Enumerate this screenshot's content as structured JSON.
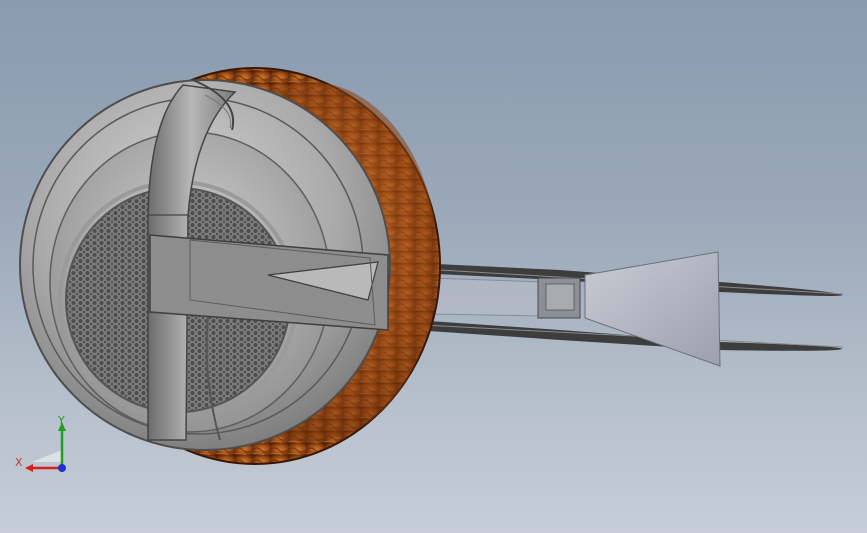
{
  "viewport": {
    "background_top": "#8a9bb0",
    "background_bottom": "#c6cdd6"
  },
  "model": {
    "wood_color": "#9a4a12",
    "metal_color": "#8f8f8f",
    "mesh_color": "#6e6e6e",
    "rod_color": "#3a3a3a"
  },
  "triad": {
    "x_label": "X",
    "y_label": "Y",
    "x_color": "#d62020",
    "y_color": "#20a020",
    "z_color": "#2030d0"
  }
}
